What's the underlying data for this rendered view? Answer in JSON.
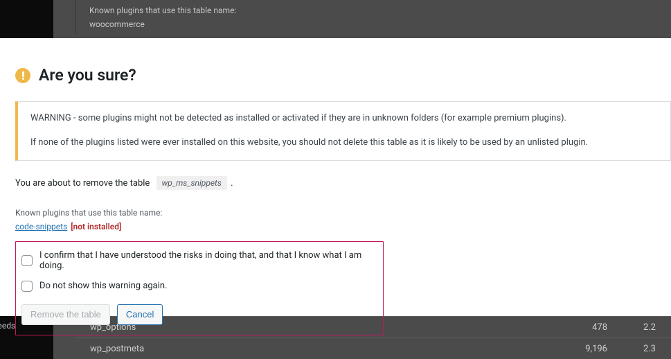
{
  "backdrop": {
    "top": {
      "known_label": "Known plugins that use this table name:",
      "plugin": "woocommerce"
    },
    "bottom": {
      "sidebar_item": "Feeds",
      "rows": [
        {
          "name": "wp_options",
          "c1": "478",
          "c2": "2.2"
        },
        {
          "name": "wp_postmeta",
          "c1": "9,196",
          "c2": "2.3"
        }
      ]
    }
  },
  "dialog": {
    "title": "Are you sure?",
    "warning_line1": "WARNING - some plugins might not be detected as installed or activated if they are in unknown folders (for example premium plugins).",
    "warning_line2": "If none of the plugins listed were ever installed on this website, you should not delete this table as it is likely to be used by an unlisted plugin.",
    "about_prefix": "You are about to remove the table",
    "table_name": "wp_ms_snippets",
    "about_suffix": ".",
    "known_label": "Known plugins that use this table name:",
    "plugin_link": "code-snippets",
    "not_installed_label": "[not installed]",
    "confirm_label": "I confirm that I have understood the risks in doing that, and that I know what I am doing.",
    "dontshow_label": "Do not show this warning again.",
    "remove_button": "Remove the table",
    "cancel_button": "Cancel"
  }
}
